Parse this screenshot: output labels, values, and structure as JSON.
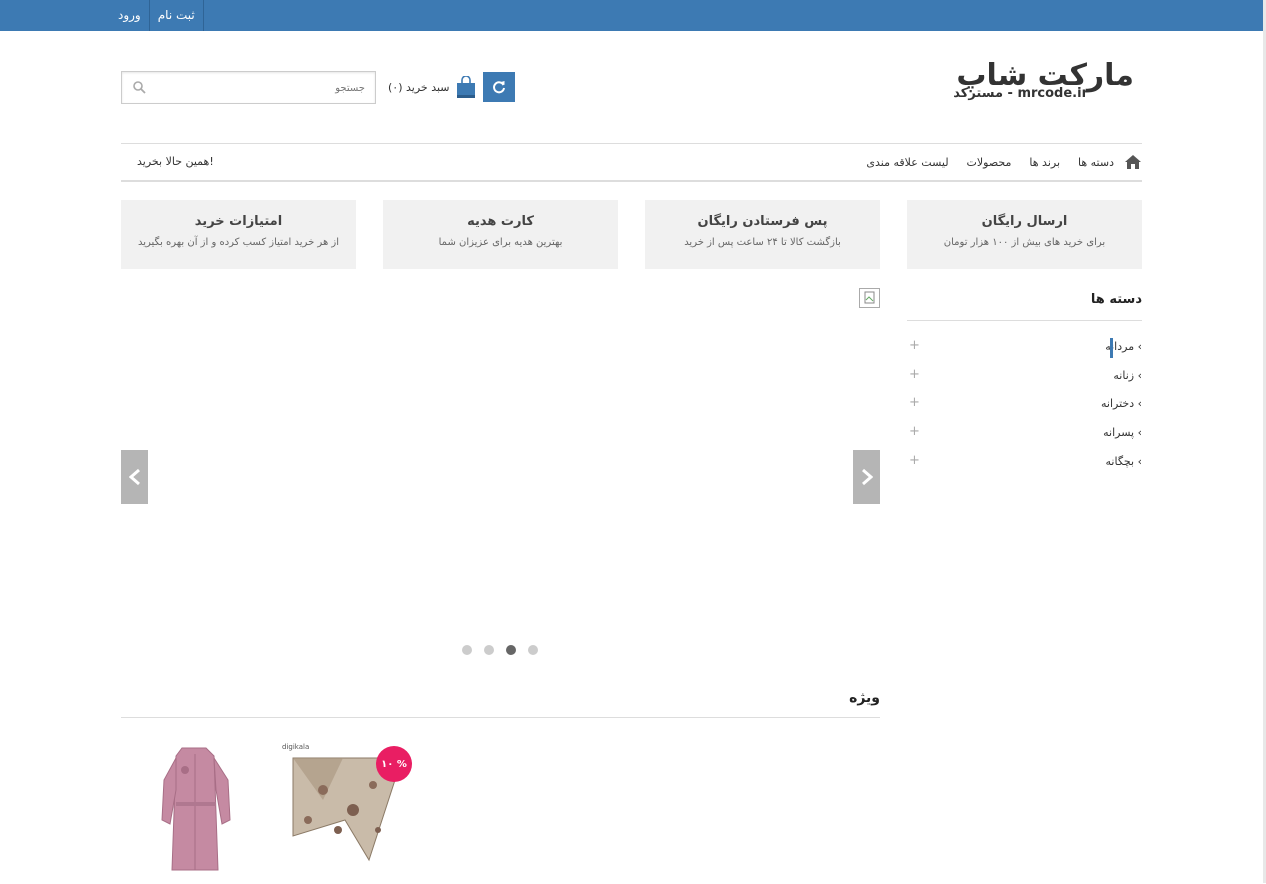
{
  "topbar": {
    "register_label": "ثبت نام",
    "login_label": "ورود"
  },
  "logo": {
    "main": "مارکت شاپ",
    "sub": "مسترکد - mrcode.ir"
  },
  "cart": {
    "label": "سبد خرید (۰)"
  },
  "search": {
    "placeholder": "جستجو"
  },
  "nav": {
    "items": [
      "دسته ها",
      "برند ها",
      "محصولات",
      "لیست علاقه مندی"
    ],
    "cta": "همین حالا بخرید!"
  },
  "features": [
    {
      "title": "ارسال رایگان",
      "desc": "برای خرید های بیش از ۱۰۰ هزار تومان"
    },
    {
      "title": "پس فرستادن رایگان",
      "desc": "بازگشت کالا تا ۲۴ ساعت پس از خرید"
    },
    {
      "title": "کارت هدیه",
      "desc": "بهترین هدیه برای عزیزان شما"
    },
    {
      "title": "امتیازات خرید",
      "desc": "از هر خرید امتیاز کسب کرده و از آن بهره بگیرید"
    }
  ],
  "sidebar": {
    "title": "دسته ها",
    "categories": [
      "مردانه",
      "زنانه",
      "دخترانه",
      "پسرانه",
      "بچگانه"
    ]
  },
  "slider": {
    "dots": 4,
    "active_dot": 2
  },
  "special": {
    "title": "ویژه",
    "products": [
      {
        "badge": "۱۰ %",
        "brand": "digikala",
        "kind": "scarf"
      },
      {
        "kind": "coat"
      }
    ]
  },
  "colors": {
    "primary": "#3d7ab3",
    "badge": "#e91e63",
    "feature_bg": "#f1f1f1"
  }
}
